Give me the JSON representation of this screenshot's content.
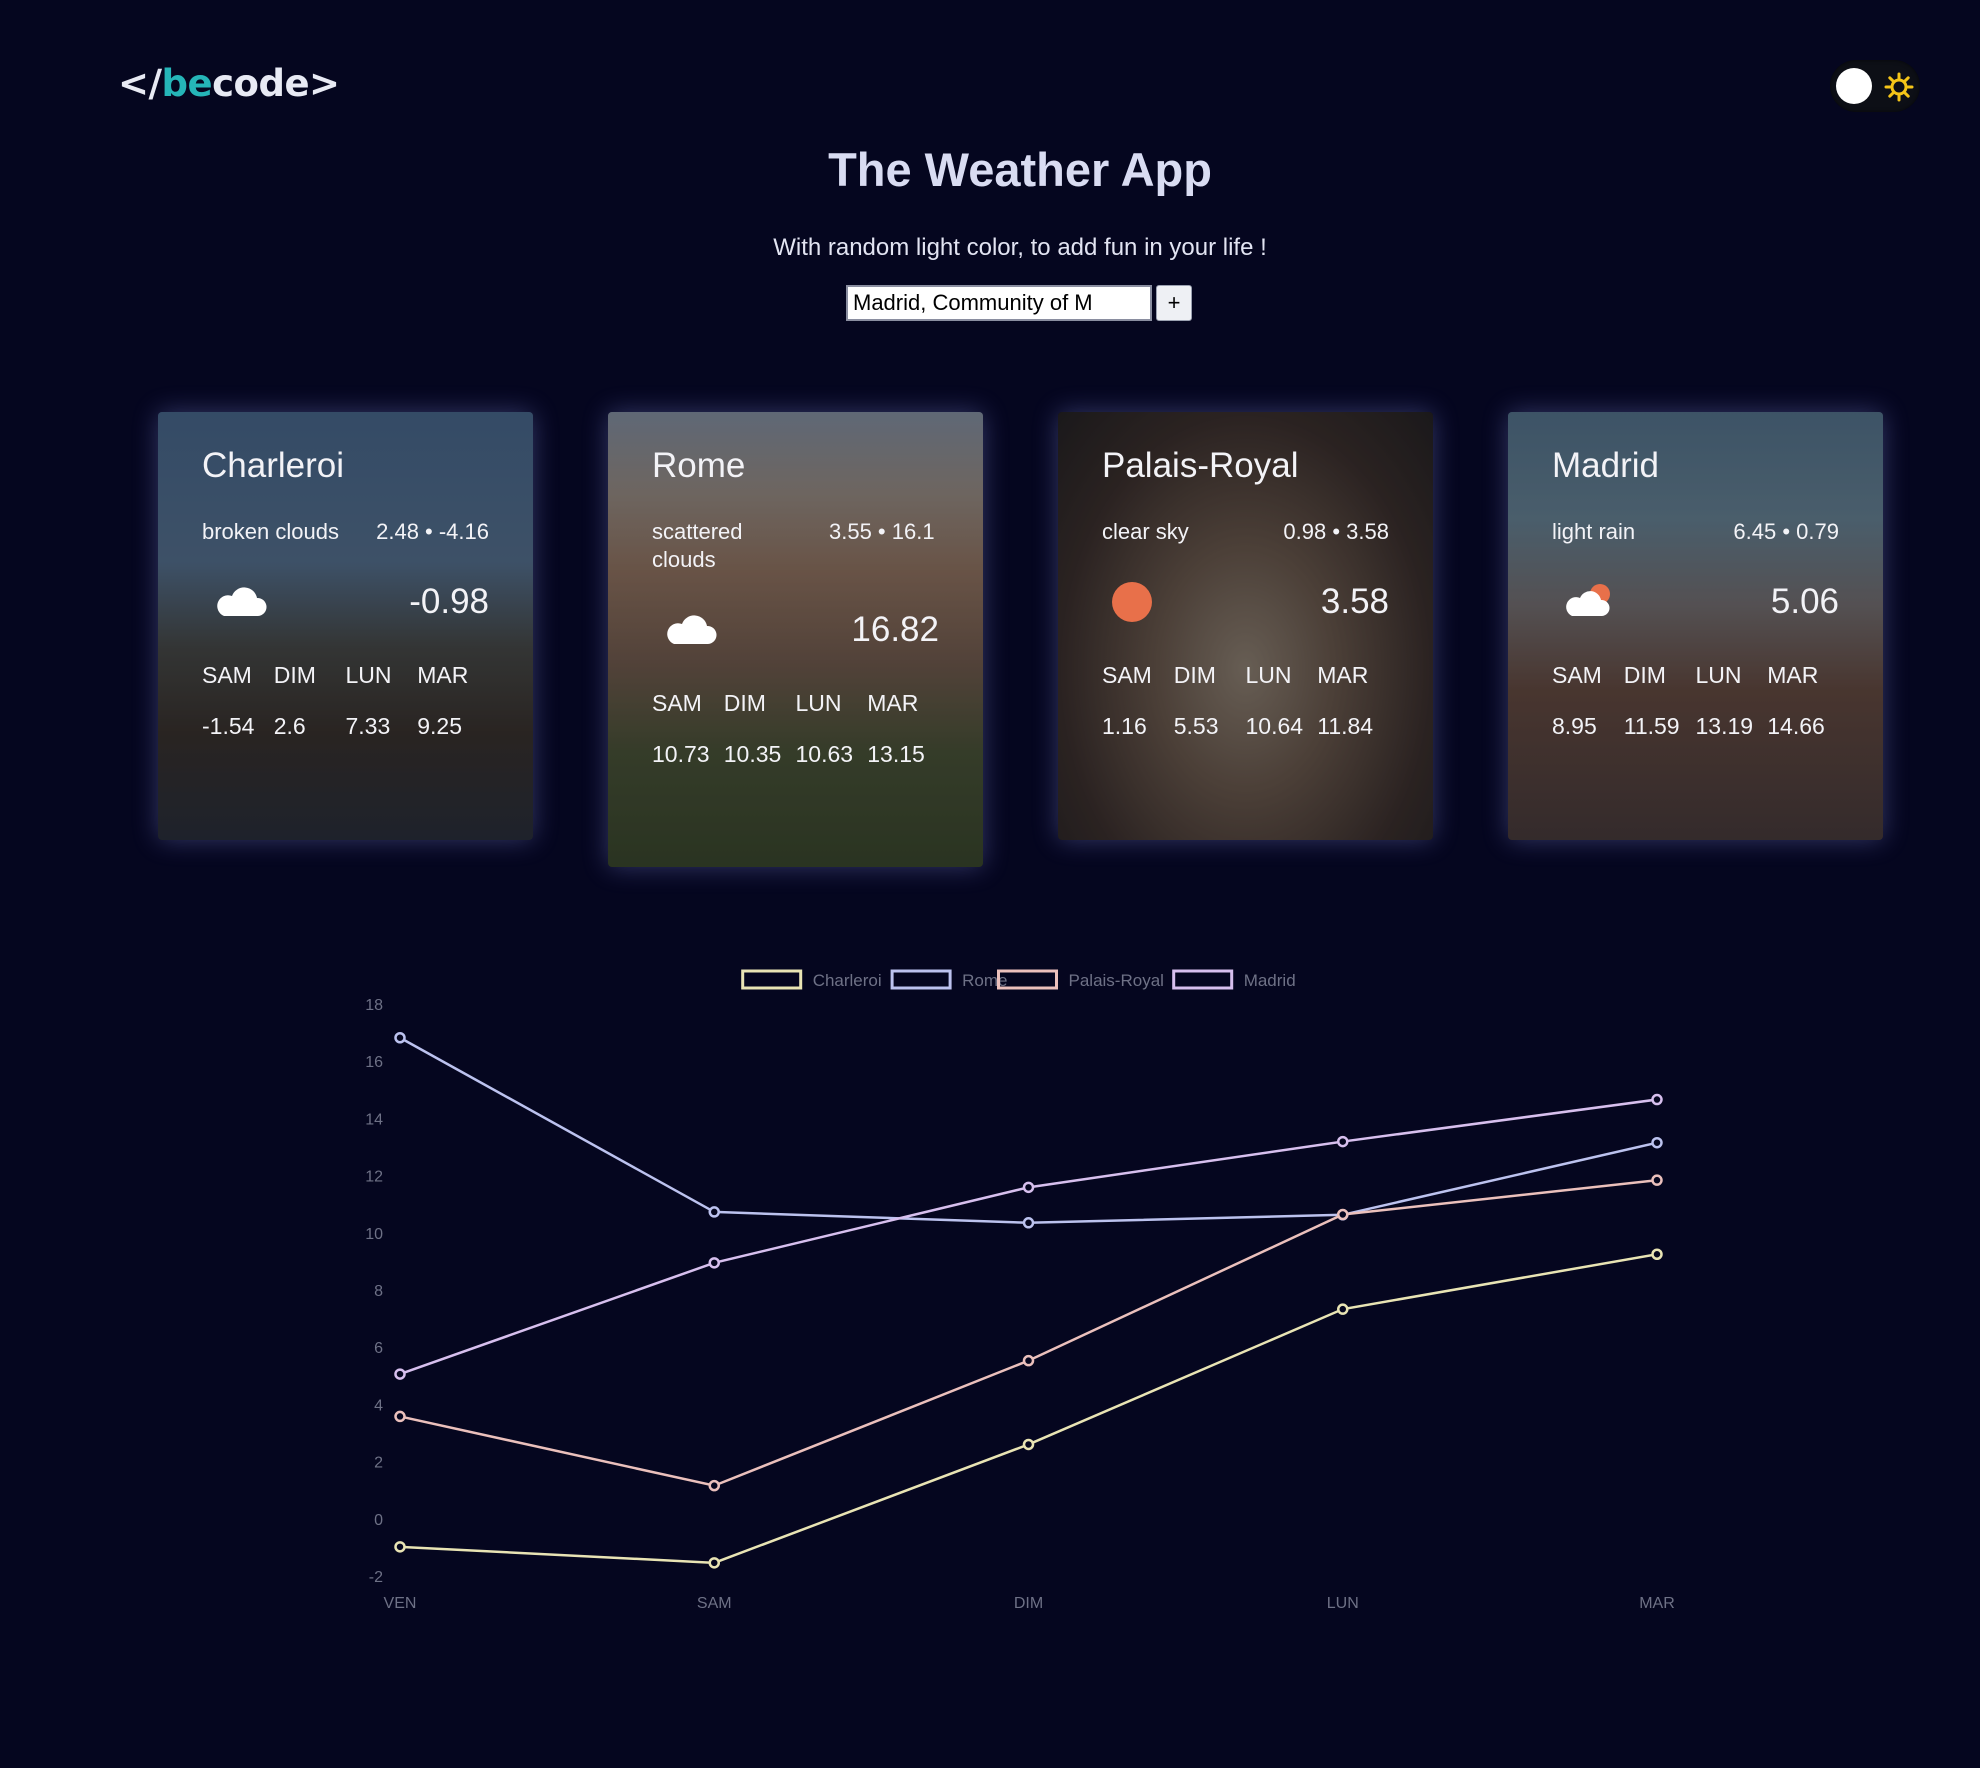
{
  "header": {
    "logo_part1": "</",
    "logo_part2": "be",
    "logo_part3": "code>",
    "theme_toggle": {
      "state": "dark",
      "icon": "sun-icon"
    }
  },
  "page": {
    "title": "The Weather App",
    "subtitle": "With random light color, to add fun in your life !"
  },
  "search": {
    "value": "Madrid, Community of M",
    "add_label": "+"
  },
  "cards": [
    {
      "city": "Charleroi",
      "description": "broken clouds",
      "minmax": "2.48 • -4.16",
      "icon": "cloud-icon",
      "temp_now": "-0.98",
      "days": [
        "SAM",
        "DIM",
        "LUN",
        "MAR"
      ],
      "values": [
        "-1.54",
        "2.6",
        "7.33",
        "9.25"
      ]
    },
    {
      "city": "Rome",
      "description": "scattered clouds",
      "minmax": "3.55 • 16.1",
      "icon": "cloud-icon",
      "temp_now": "16.82",
      "days": [
        "SAM",
        "DIM",
        "LUN",
        "MAR"
      ],
      "values": [
        "10.73",
        "10.35",
        "10.63",
        "13.15"
      ]
    },
    {
      "city": "Palais-Royal",
      "description": "clear sky",
      "minmax": "0.98 • 3.58",
      "icon": "sun-icon",
      "temp_now": "3.58",
      "days": [
        "SAM",
        "DIM",
        "LUN",
        "MAR"
      ],
      "values": [
        "1.16",
        "5.53",
        "10.64",
        "11.84"
      ]
    },
    {
      "city": "Madrid",
      "description": "light rain",
      "minmax": "6.45 • 0.79",
      "icon": "cloud-sun-icon",
      "temp_now": "5.06",
      "days": [
        "SAM",
        "DIM",
        "LUN",
        "MAR"
      ],
      "values": [
        "8.95",
        "11.59",
        "13.19",
        "14.66"
      ]
    }
  ],
  "colors": {
    "background": "#05061f",
    "accent_logo": "#25b5b8",
    "sun": "#e8704a",
    "charleroi": "#e9e4b4",
    "rome": "#bcc2ef",
    "palais_royal": "#ebc0bc",
    "madrid": "#d7bfee"
  },
  "chart_data": {
    "type": "line",
    "categories": [
      "VEN",
      "SAM",
      "DIM",
      "LUN",
      "MAR"
    ],
    "ylim": [
      -2,
      18
    ],
    "yticks": [
      -2,
      0,
      2,
      4,
      6,
      8,
      10,
      12,
      14,
      16,
      18
    ],
    "grid": false,
    "legend_position": "top-center",
    "series": [
      {
        "name": "Charleroi",
        "color": "#e9e4b4",
        "values": [
          -0.98,
          -1.54,
          2.6,
          7.33,
          9.25
        ]
      },
      {
        "name": "Rome",
        "color": "#bcc2ef",
        "values": [
          16.82,
          10.73,
          10.35,
          10.63,
          13.15
        ]
      },
      {
        "name": "Palais-Royal",
        "color": "#ebc0bc",
        "values": [
          3.58,
          1.16,
          5.53,
          10.64,
          11.84
        ]
      },
      {
        "name": "Madrid",
        "color": "#d7bfee",
        "values": [
          5.06,
          8.95,
          11.59,
          13.19,
          14.66
        ]
      }
    ]
  }
}
